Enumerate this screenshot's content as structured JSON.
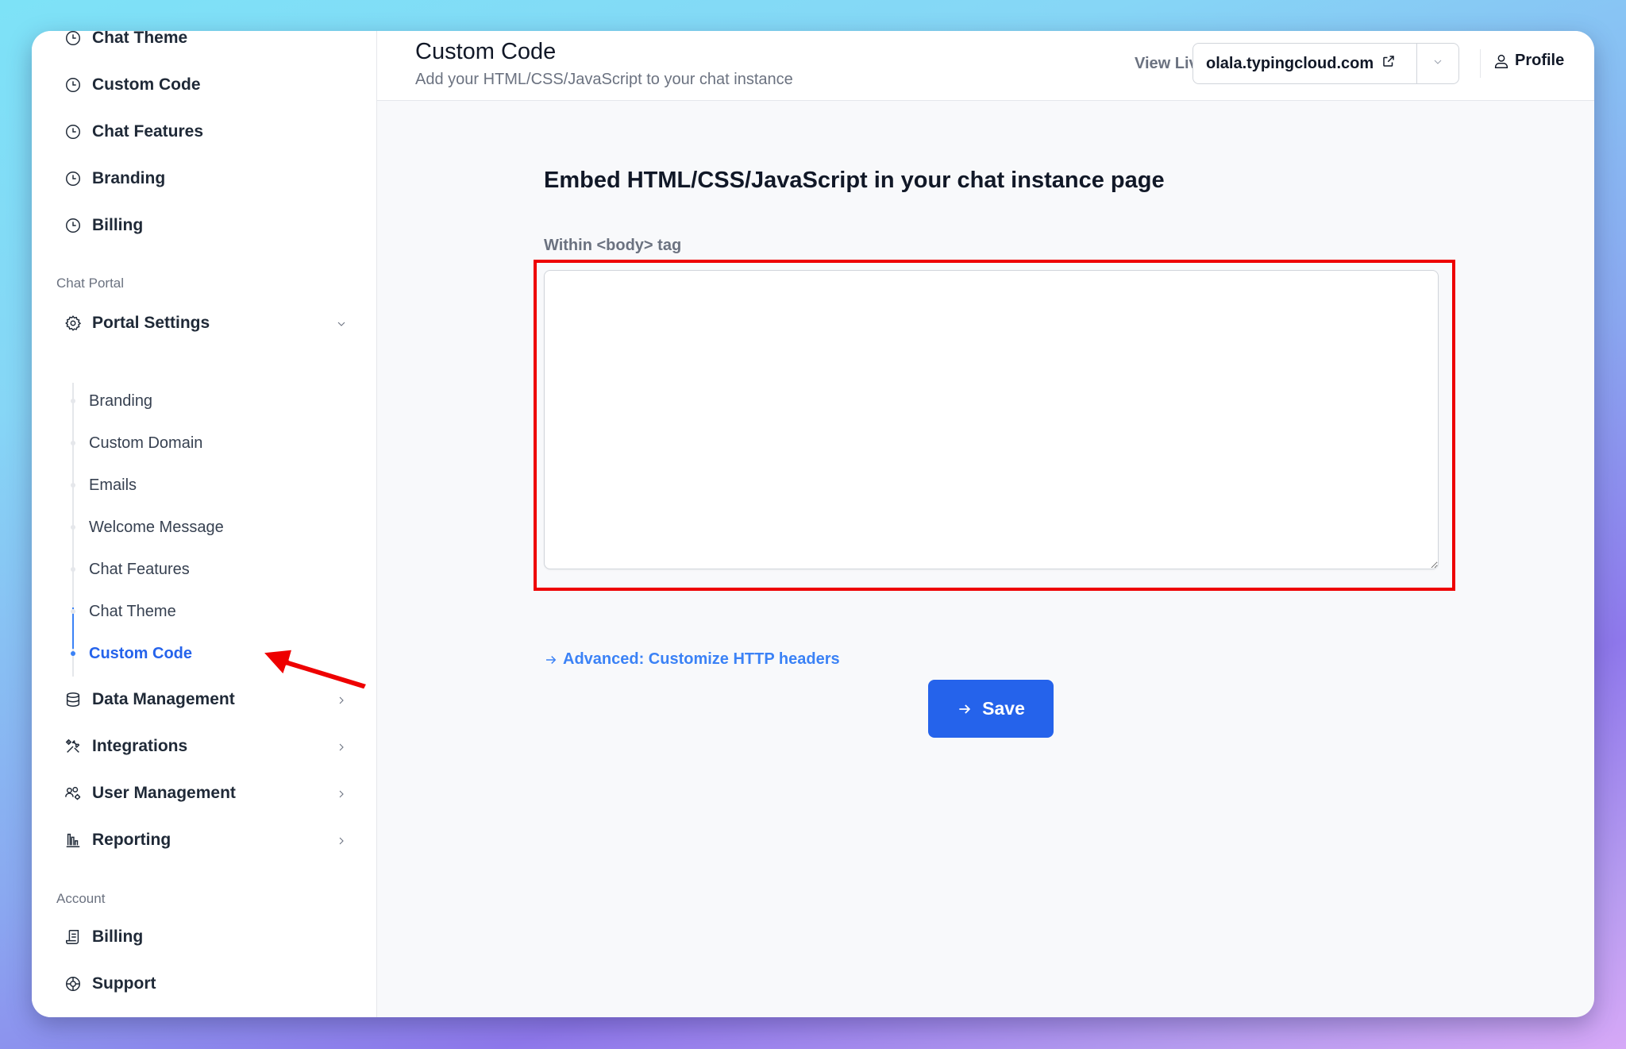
{
  "sidebar": {
    "top_items": [
      {
        "label": "Chat Theme",
        "icon": "clock-icon"
      },
      {
        "label": "Custom Code",
        "icon": "clock-icon"
      },
      {
        "label": "Chat Features",
        "icon": "clock-icon"
      },
      {
        "label": "Branding",
        "icon": "clock-icon"
      },
      {
        "label": "Billing",
        "icon": "clock-icon"
      }
    ],
    "section_chat_portal": "Chat Portal",
    "portal_settings": {
      "label": "Portal Settings",
      "icon": "gear-icon",
      "expanded": true,
      "sub_items": [
        {
          "label": "Branding",
          "active": false
        },
        {
          "label": "Custom Domain",
          "active": false
        },
        {
          "label": "Emails",
          "active": false
        },
        {
          "label": "Welcome Message",
          "active": false
        },
        {
          "label": "Chat Features",
          "active": false
        },
        {
          "label": "Chat Theme",
          "active": false
        },
        {
          "label": "Custom Code",
          "active": true
        }
      ]
    },
    "groups": [
      {
        "label": "Data Management",
        "icon": "database-icon"
      },
      {
        "label": "Integrations",
        "icon": "tools-icon"
      },
      {
        "label": "User Management",
        "icon": "users-gear-icon"
      },
      {
        "label": "Reporting",
        "icon": "bar-chart-icon"
      }
    ],
    "section_account": "Account",
    "account_items": [
      {
        "label": "Billing",
        "icon": "receipt-icon"
      },
      {
        "label": "Support",
        "icon": "lifebuoy-icon"
      }
    ]
  },
  "header": {
    "title": "Custom Code",
    "subtitle": "Add your HTML/CSS/JavaScript to your chat instance",
    "view_live_label": "View Live:",
    "view_live_url": "olala.typingcloud.com",
    "profile_label": "Profile"
  },
  "main": {
    "heading": "Embed HTML/CSS/JavaScript in your chat instance page",
    "field_label": "Within <body> tag",
    "textarea_value": "",
    "advanced_link": "Advanced: Customize HTTP headers",
    "save_label": "Save"
  },
  "colors": {
    "accent": "#2563eb",
    "link": "#3b82f6",
    "annotation": "#ee0000"
  }
}
